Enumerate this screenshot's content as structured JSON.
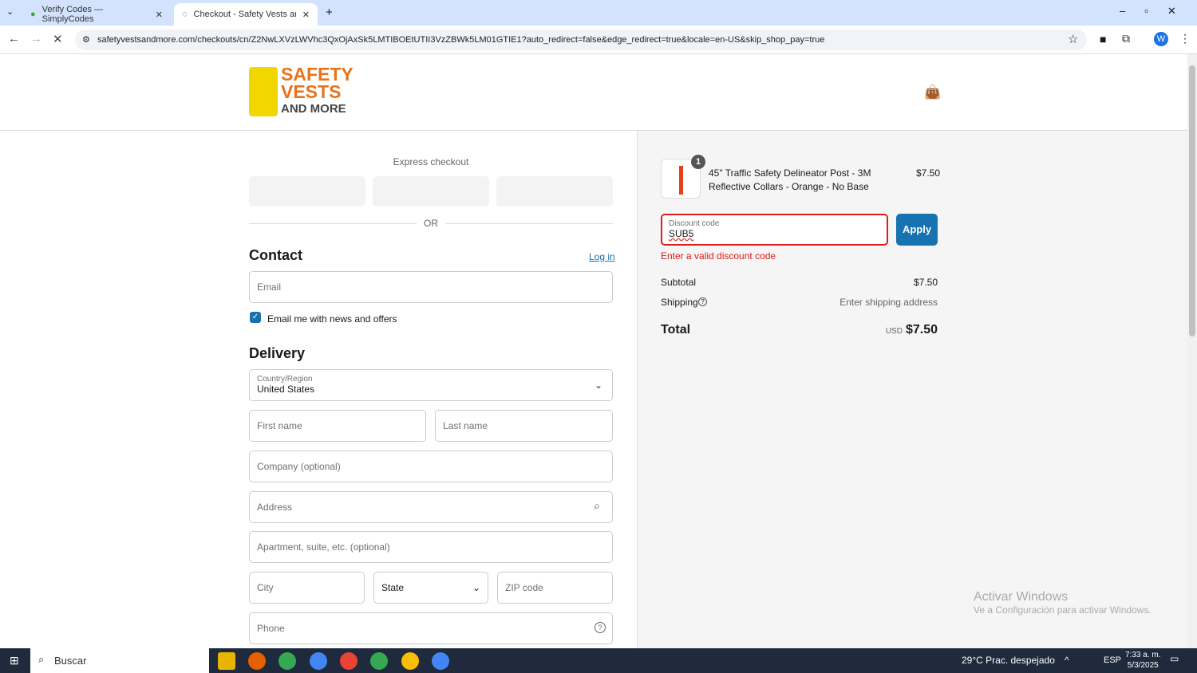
{
  "browser": {
    "tabs": [
      {
        "label": "Verify Codes — SimplyCodes"
      },
      {
        "label": "Checkout - Safety Vests and Mo"
      }
    ],
    "url": "safetyvestsandmore.com/checkouts/cn/Z2NwLXVzLWVhc3QxOjAxSk5LMTIBOEtUTII3VzZBWk5LM01GTIE1?auto_redirect=false&edge_redirect=true&locale=en-US&skip_shop_pay=true",
    "profile": "W"
  },
  "logo": {
    "line1": "SAFETY",
    "line2": "VESTS",
    "line3": "AND MORE"
  },
  "checkout": {
    "express": "Express checkout",
    "or": "OR",
    "contact": "Contact",
    "login": "Log in",
    "email_ph": "Email",
    "news": "Email me with news and offers",
    "delivery": "Delivery",
    "country_label": "Country/Region",
    "country": "United States",
    "first": "First name",
    "last": "Last name",
    "company": "Company (optional)",
    "address": "Address",
    "apt": "Apartment, suite, etc. (optional)",
    "city": "City",
    "state": "State",
    "zip": "ZIP code",
    "phone": "Phone"
  },
  "summary": {
    "qty": "1",
    "item": "45\" Traffic Safety Delineator Post - 3M Reflective Collars - Orange - No Base",
    "item_price": "$7.50",
    "discount_label": "Discount code",
    "discount_value": "SUB5",
    "apply": "Apply",
    "error": "Enter a valid discount code",
    "subtotal_label": "Subtotal",
    "subtotal": "$7.50",
    "shipping_label": "Shipping",
    "shipping": "Enter shipping address",
    "total_label": "Total",
    "currency": "USD",
    "total": "$7.50"
  },
  "watermark": {
    "title": "Activar Windows",
    "sub": "Ve a Configuración para activar Windows."
  },
  "taskbar": {
    "search": "Buscar",
    "weather": "29°C  Prac. despejado",
    "lang": "ESP",
    "time": "7:33 a. m.",
    "date": "5/3/2025"
  },
  "colors": {
    "accent": "#1773b0",
    "error": "#dd1d1d"
  }
}
